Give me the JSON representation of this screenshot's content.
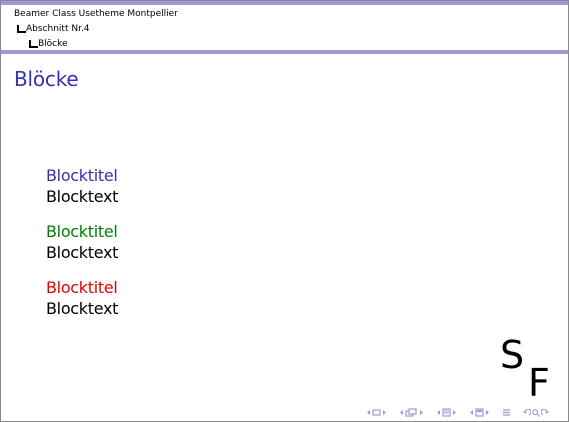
{
  "header": {
    "tree": {
      "title": "Beamer Class Usetheme Montpellier",
      "section": "Abschnitt Nr.4",
      "subsection": "Blöcke"
    }
  },
  "frame": {
    "title": "Blöcke"
  },
  "blocks": [
    {
      "title": "Blocktitel",
      "text": "Blocktext",
      "title_color": "#3333b2"
    },
    {
      "title": "Blocktitel",
      "text": "Blocktext",
      "title_color": "#007f00"
    },
    {
      "title": "Blocktitel",
      "text": "Blocktext",
      "title_color": "#e60000"
    }
  ],
  "logo": {
    "letter_top": "S",
    "letter_bottom": "F"
  },
  "navigation": {
    "icons": [
      "nav-frame-icon",
      "nav-subsection-icon",
      "nav-section-icon",
      "nav-document-icon",
      "nav-appendix-icon",
      "search-icon"
    ],
    "accent_color": "#9b9bd6"
  },
  "theme": {
    "bar_color": "#9b9bd6",
    "title_color": "#3333b2"
  }
}
